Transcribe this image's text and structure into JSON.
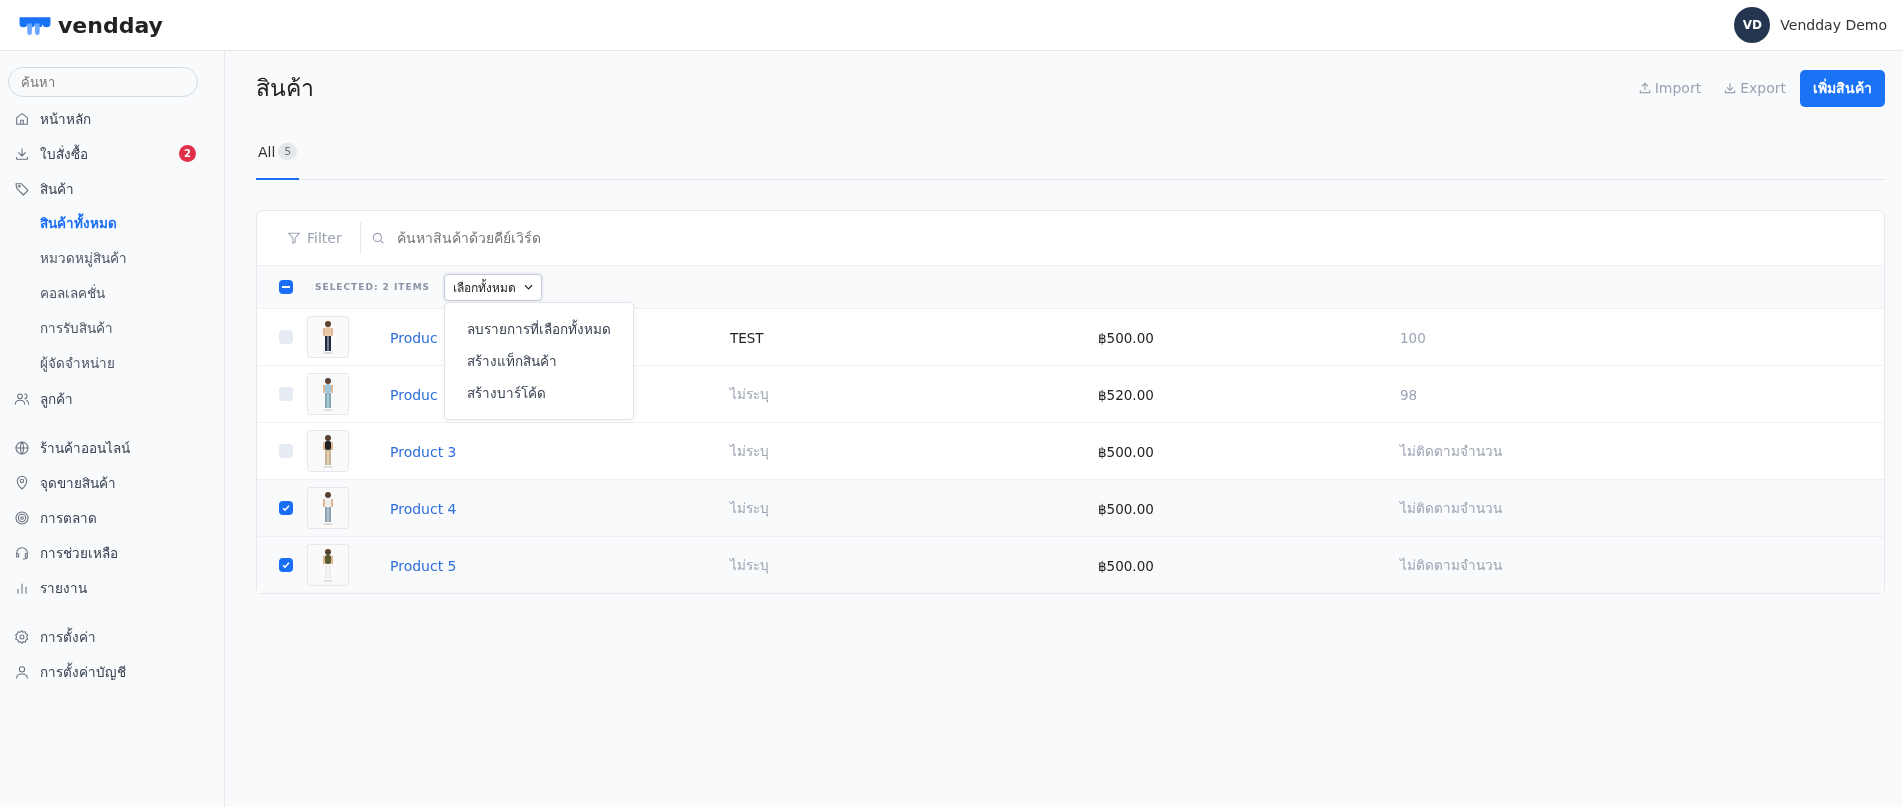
{
  "header": {
    "logo": "vendday",
    "user": {
      "initials": "VD",
      "name": "Vendday Demo"
    }
  },
  "sidebar": {
    "search": {
      "placeholder": "ค้นหา"
    },
    "groups": [
      [
        {
          "label": "หน้าหลัก",
          "selected": false
        },
        {
          "label": "ใบสั่งซื้อ",
          "selected": false,
          "badge": "2"
        },
        {
          "label": "สินค้า",
          "selected": false,
          "children": [
            {
              "label": "สินค้าทั้งหมด",
              "selected": true
            },
            {
              "label": "หมวดหมู่สินค้า",
              "selected": false
            },
            {
              "label": "คอลเลคชั่น",
              "selected": false
            },
            {
              "label": "การรับสินค้า",
              "selected": false
            },
            {
              "label": "ผู้จัดจำหน่าย",
              "selected": false
            }
          ]
        },
        {
          "label": "ลูกค้า",
          "selected": false
        }
      ],
      [
        {
          "label": "ร้านค้าออนไลน์",
          "selected": false
        },
        {
          "label": "จุดขายสินค้า",
          "selected": false
        },
        {
          "label": "การตลาด",
          "selected": false
        },
        {
          "label": "การช่วยเหลือ",
          "selected": false
        },
        {
          "label": "รายงาน",
          "selected": false
        }
      ],
      [
        {
          "label": "การตั้งค่า",
          "selected": false
        },
        {
          "label": "การตั้งค่าบัญชี",
          "selected": false
        }
      ]
    ]
  },
  "page": {
    "title": "สินค้า",
    "actions": {
      "import": "Import",
      "export": "Export",
      "add": "เพิ่มสินค้า"
    },
    "tabs": [
      {
        "label": "All",
        "count": "5",
        "selected": true
      }
    ]
  },
  "toolbar": {
    "filter": "Filter",
    "search": {
      "placeholder": "ค้นหาสินค้าด้วยคีย์เวิร์ด"
    }
  },
  "selection": {
    "indeterminate": true,
    "label": "SELECTED: 2 ITEMS",
    "dropdown": {
      "label": "เลือกทั้งหมด",
      "expanded": true,
      "options": [
        "ลบรายการที่เลือกทั้งหมด",
        "สร้างแท็กสินค้า",
        "สร้างบาร์โค้ด"
      ]
    }
  },
  "rows": [
    {
      "selected": false,
      "name": "Produc",
      "column_2": "TEST",
      "price": "฿500.00",
      "stock": "100"
    },
    {
      "selected": false,
      "name": "Produc",
      "column_2": "ไม่ระบุ",
      "price": "฿520.00",
      "stock": "98"
    },
    {
      "selected": false,
      "name": "Product 3",
      "column_2": "ไม่ระบุ",
      "price": "฿500.00",
      "stock": "ไม่ติดตามจำนวน"
    },
    {
      "selected": true,
      "name": "Product 4",
      "column_2": "ไม่ระบุ",
      "price": "฿500.00",
      "stock": "ไม่ติดตามจำนวน"
    },
    {
      "selected": true,
      "name": "Product 5",
      "column_2": "ไม่ระบุ",
      "price": "฿500.00",
      "stock": "ไม่ติดตามจำนวน"
    }
  ]
}
